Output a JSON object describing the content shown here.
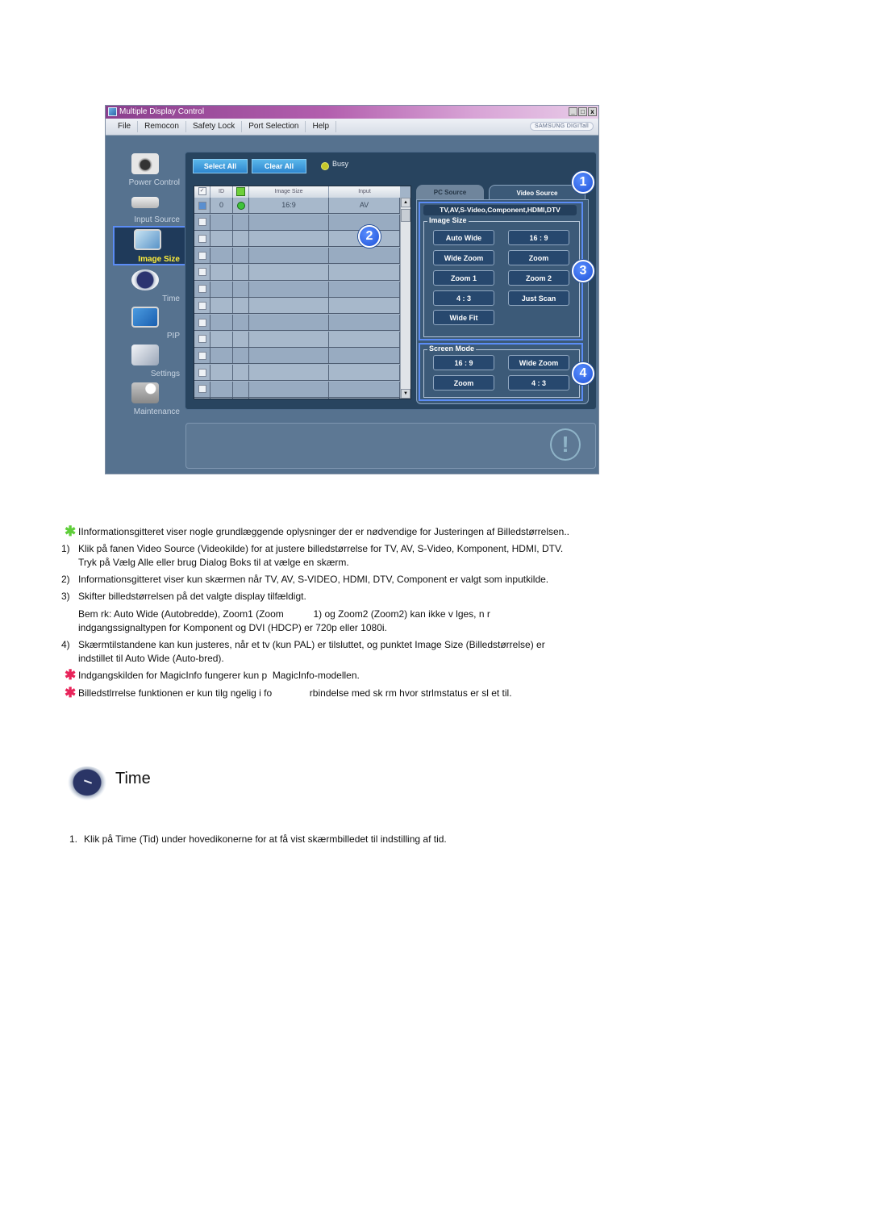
{
  "window": {
    "title": "Multiple Display Control",
    "window_buttons": [
      "_",
      "□",
      "x"
    ],
    "brand": "SAMSUNG DIGITall",
    "menu": [
      "File",
      "Remocon",
      "Safety Lock",
      "Port Selection",
      "Help"
    ],
    "sidebar": [
      {
        "label": "Power Control",
        "icon": "power-control-icon",
        "active": false
      },
      {
        "label": "Input Source",
        "icon": "input-source-icon",
        "active": false
      },
      {
        "label": "Image Size",
        "icon": "image-size-icon",
        "active": true
      },
      {
        "label": "Time",
        "icon": "time-icon",
        "active": false
      },
      {
        "label": "PIP",
        "icon": "pip-icon",
        "active": false
      },
      {
        "label": "Settings",
        "icon": "settings-icon",
        "active": false
      },
      {
        "label": "Maintenance",
        "icon": "maintenance-icon",
        "active": false
      }
    ],
    "toolbar": {
      "select_all": "Select All",
      "clear_all": "Clear All",
      "busy": "Busy"
    },
    "grid": {
      "headers": [
        "",
        "ID",
        "",
        "Image Size",
        "Input"
      ],
      "rows": [
        {
          "checked": true,
          "id": "0",
          "status": "on",
          "image_size": "16:9",
          "input": "AV"
        }
      ],
      "empty_rows": 12
    },
    "tabs": [
      "PC Source",
      "Video Source"
    ],
    "active_tab": "Video Source",
    "source_label": "TV,AV,S-Video,Component,HDMI,DTV",
    "image_size": {
      "legend": "Image Size",
      "options": [
        "Auto Wide",
        "16 : 9",
        "Wide Zoom",
        "Zoom",
        "Zoom 1",
        "Zoom 2",
        "4 : 3",
        "Just Scan",
        "Wide Fit"
      ]
    },
    "screen_mode": {
      "legend": "Screen Mode",
      "options": [
        "16 : 9",
        "Wide Zoom",
        "Zoom",
        "4 : 3"
      ]
    },
    "callouts": [
      "1",
      "2",
      "3",
      "4"
    ],
    "colors": {
      "highlight": "#5b8cf5",
      "active_label": "#ffee3a",
      "callout": "#1f52d8"
    }
  },
  "notes": {
    "intro": "IInformationsgitteret viser nogle grundlæggende oplysninger der er nødvendige for Justeringen af Billedstørrelsen..",
    "items": [
      {
        "num": "1)",
        "lines": [
          "Klik på fanen Video Source (Videokilde) for at justere billedstørrelse for TV, AV, S-Video, Komponent, HDMI, DTV.",
          "Tryk på Vælg Alle eller brug Dialog Boks til at vælge en skærm."
        ]
      },
      {
        "num": "2)",
        "lines": [
          "Informationsgitteret viser kun skærmen når TV, AV, S-VIDEO, HDMI, DTV, Component er valgt som inputkilde."
        ]
      },
      {
        "num": "3)",
        "lines": [
          "Skifter billedstørrelsen på det valgte display tilfældigt."
        ]
      },
      {
        "num": "",
        "lines": [
          "Bem rk: Auto Wide (Autobredde), Zoom1 (Zoom           1) og Zoom2 (Zoom2) kan ikke v lges, n r",
          "indgangssignaltypen for Komponent og DVI (HDCP) er 720p eller 1080i."
        ]
      },
      {
        "num": "4)",
        "lines": [
          "Skærmtilstandene kan kun justeres, når et tv (kun PAL) er tilsluttet, og punktet Image Size (Billedstørrelse) er",
          "indstillet til Auto Wide (Auto-bred)."
        ]
      }
    ],
    "warnings": [
      "Indgangskilden for MagicInfo fungerer kun p  MagicInfo-modellen.",
      "Billedstlrrelse funktionen er kun tilg ngelig i fo              rbindelse med sk rm hvor strlmstatus er sl et til."
    ],
    "star_colors": {
      "info": "#5fce3a",
      "warning": "#e8245a"
    }
  },
  "section": {
    "title": "Time",
    "icon": "time-clock-icon",
    "steps": [
      {
        "num": "1.",
        "text": "Klik på Time (Tid) under hovedikonerne for at få vist skærmbilledet til indstilling af tid."
      }
    ]
  }
}
